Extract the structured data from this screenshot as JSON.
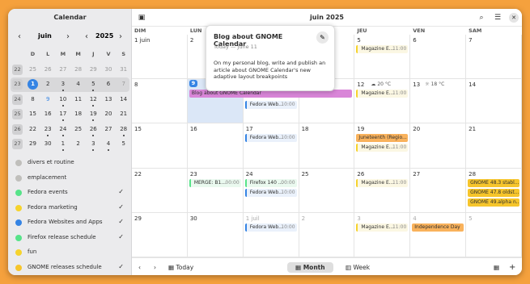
{
  "sidebar": {
    "title": "Calendar",
    "month": "juin",
    "year": "2025",
    "dow": [
      "D",
      "L",
      "M",
      "M",
      "J",
      "V",
      "S"
    ],
    "weeks": [
      {
        "wk": "22",
        "days": [
          {
            "d": "25",
            "dim": true
          },
          {
            "d": "26",
            "dim": true
          },
          {
            "d": "27",
            "dim": true
          },
          {
            "d": "28",
            "dim": true
          },
          {
            "d": "29",
            "dim": true
          },
          {
            "d": "30",
            "dim": true
          },
          {
            "d": "31",
            "dim": true
          }
        ]
      },
      {
        "wk": "23",
        "sel": true,
        "days": [
          {
            "d": "1",
            "today": true
          },
          {
            "d": "2"
          },
          {
            "d": "3",
            "dot": true
          },
          {
            "d": "4"
          },
          {
            "d": "5",
            "dot": true
          },
          {
            "d": "6"
          },
          {
            "d": "7",
            "dim": true
          }
        ]
      },
      {
        "wk": "24",
        "days": [
          {
            "d": "8"
          },
          {
            "d": "9",
            "link": true
          },
          {
            "d": "10",
            "dot": true
          },
          {
            "d": "11"
          },
          {
            "d": "12",
            "dot": true
          },
          {
            "d": "13"
          },
          {
            "d": "14"
          }
        ]
      },
      {
        "wk": "25",
        "days": [
          {
            "d": "15"
          },
          {
            "d": "16"
          },
          {
            "d": "17",
            "dot": true
          },
          {
            "d": "18"
          },
          {
            "d": "19",
            "dot": true
          },
          {
            "d": "20"
          },
          {
            "d": "21"
          }
        ]
      },
      {
        "wk": "26",
        "days": [
          {
            "d": "22"
          },
          {
            "d": "23",
            "dot": true
          },
          {
            "d": "24",
            "dot": true
          },
          {
            "d": "25"
          },
          {
            "d": "26",
            "dot": true
          },
          {
            "d": "27"
          },
          {
            "d": "28",
            "dot": true
          }
        ]
      },
      {
        "wk": "27",
        "days": [
          {
            "d": "29"
          },
          {
            "d": "30"
          },
          {
            "d": "1",
            "dot": true
          },
          {
            "d": "2"
          },
          {
            "d": "3",
            "dot": true
          },
          {
            "d": "4",
            "dot": true
          },
          {
            "d": "5"
          }
        ]
      }
    ],
    "calendars": [
      {
        "name": "divers et routine",
        "color": "#c0bfbc",
        "checked": false
      },
      {
        "name": "emplacement",
        "color": "#c0bfbc",
        "checked": false
      },
      {
        "name": "Fedora events",
        "color": "#57e389",
        "checked": true
      },
      {
        "name": "Fedora marketing",
        "color": "#f6d32d",
        "checked": true
      },
      {
        "name": "Fedora Websites and Apps",
        "color": "#3584e4",
        "checked": true
      },
      {
        "name": "Firefox release schedule",
        "color": "#57e389",
        "checked": true
      },
      {
        "name": "fun",
        "color": "#f6d32d",
        "checked": false
      },
      {
        "name": "GNOME releases schedule",
        "color": "#f6c52b",
        "checked": true
      }
    ]
  },
  "header": {
    "title": "juin 2025"
  },
  "grid": {
    "dow": [
      "DIM",
      "LUN",
      "MAR",
      "MER",
      "JEU",
      "VEN",
      "SAM"
    ],
    "rows": [
      [
        "1 juin",
        "2",
        "3",
        "4",
        "5",
        "6",
        "7"
      ],
      [
        "8",
        "9",
        "10",
        "11",
        "12",
        "13",
        "14"
      ],
      [
        "15",
        "16",
        "17",
        "18",
        "19",
        "20",
        "21"
      ],
      [
        "22",
        "23",
        "24",
        "25",
        "26",
        "27",
        "28"
      ],
      [
        "29",
        "30",
        "1 juil",
        "2",
        "3",
        "4",
        "5"
      ]
    ],
    "weather": [
      {
        "text": "☁ 20 °C"
      },
      {
        "text": "☼ 18 °C"
      }
    ]
  },
  "events": {
    "magazine": "Magazine E...",
    "magazine_time": "11:00",
    "fedora_web": "Fedora Web...",
    "fedora_web_time": "10:00",
    "blog": "Blog about GNOME Calendar",
    "juneteenth": "Juneteenth (Regio...",
    "merge": "MERGE: B1...",
    "merge_time": "00:00",
    "firefox": "Firefox 140 ...",
    "firefox_time": "00:00",
    "gnome1": "GNOME 48.3 stabl...",
    "gnome2": "GNOME 47.8 oldst...",
    "gnome3": "GNOME 49.alpha n...",
    "independence": "Independence Day"
  },
  "popover": {
    "title": "Blog about GNOME Calendar",
    "sub": "Today — June 11",
    "desc": "On my personal blog, write and publish an article about GNOME Calendar's new adaptive layout breakpoints"
  },
  "footer": {
    "today": "Today",
    "month": "Month",
    "week": "Week"
  }
}
